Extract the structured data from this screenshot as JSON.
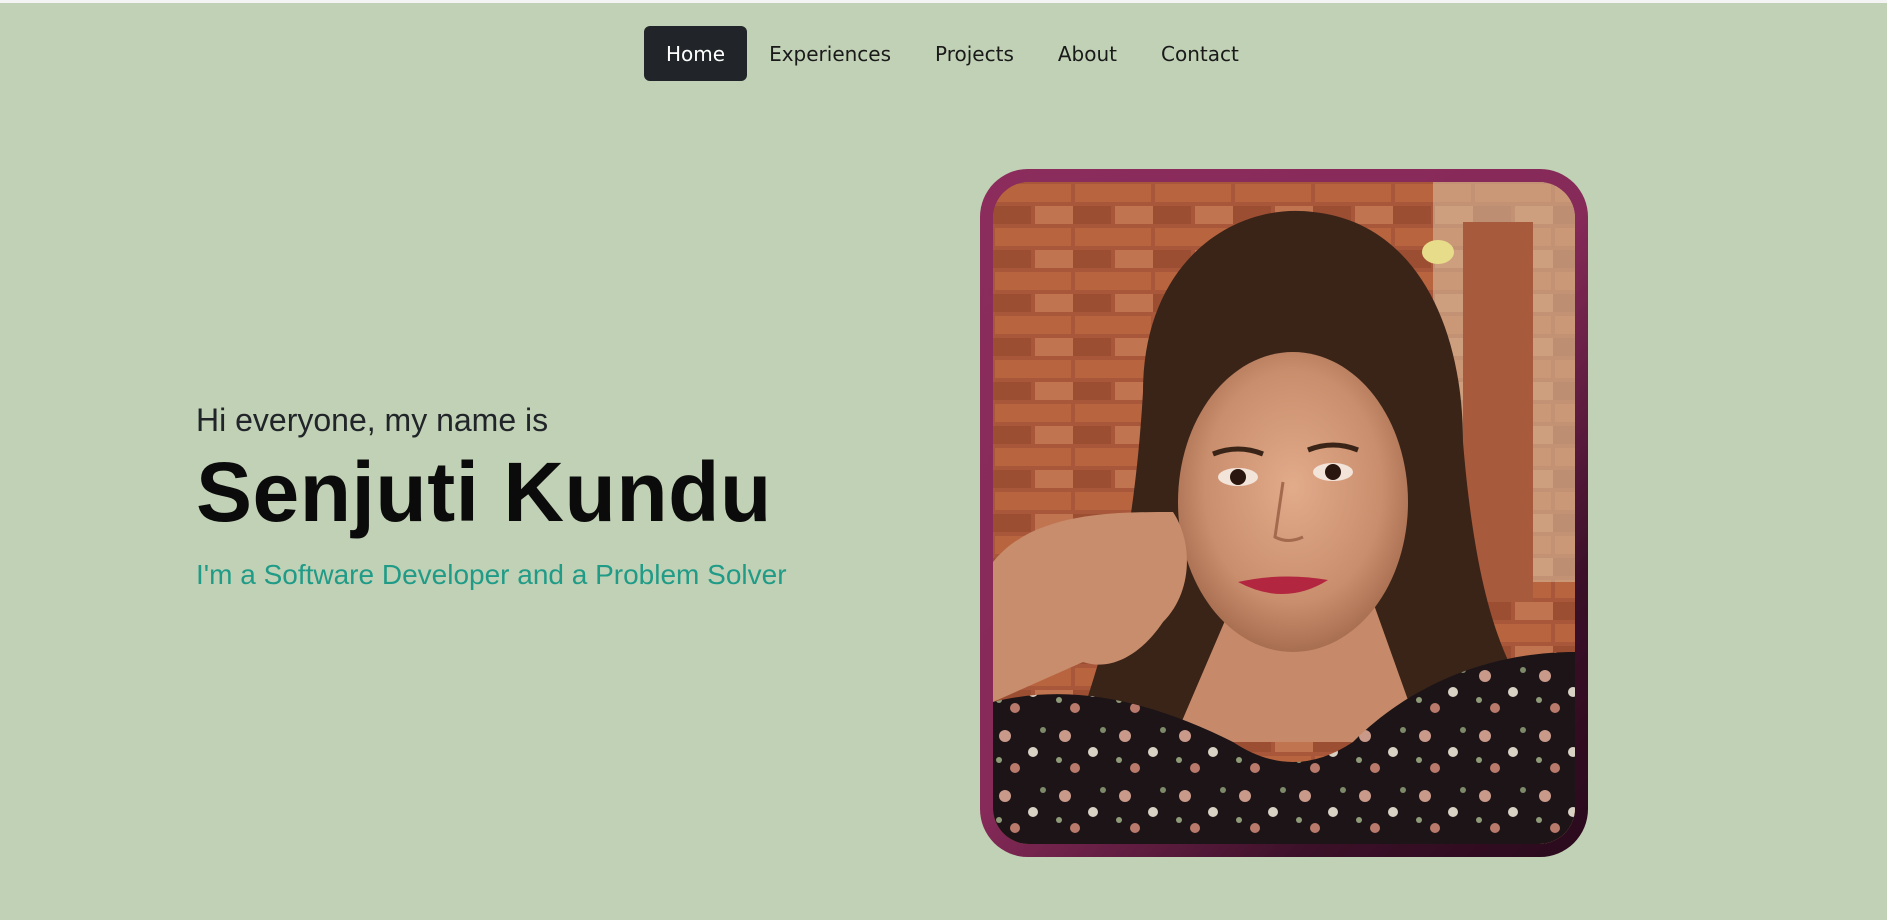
{
  "nav": {
    "items": [
      {
        "label": "Home",
        "active": true
      },
      {
        "label": "Experiences",
        "active": false
      },
      {
        "label": "Projects",
        "active": false
      },
      {
        "label": "About",
        "active": false
      },
      {
        "label": "Contact",
        "active": false
      }
    ]
  },
  "hero": {
    "greeting": "Hi everyone, my name is",
    "name": "Senjuti Kundu",
    "tagline": "I'm a Software Developer and a Problem Solver"
  },
  "colors": {
    "background": "#c1d1b5",
    "nav_active_bg": "#212529",
    "tagline": "#1f9b87",
    "frame": "#8b2c5c"
  },
  "profile_photo": {
    "alt": "profile-photo"
  }
}
